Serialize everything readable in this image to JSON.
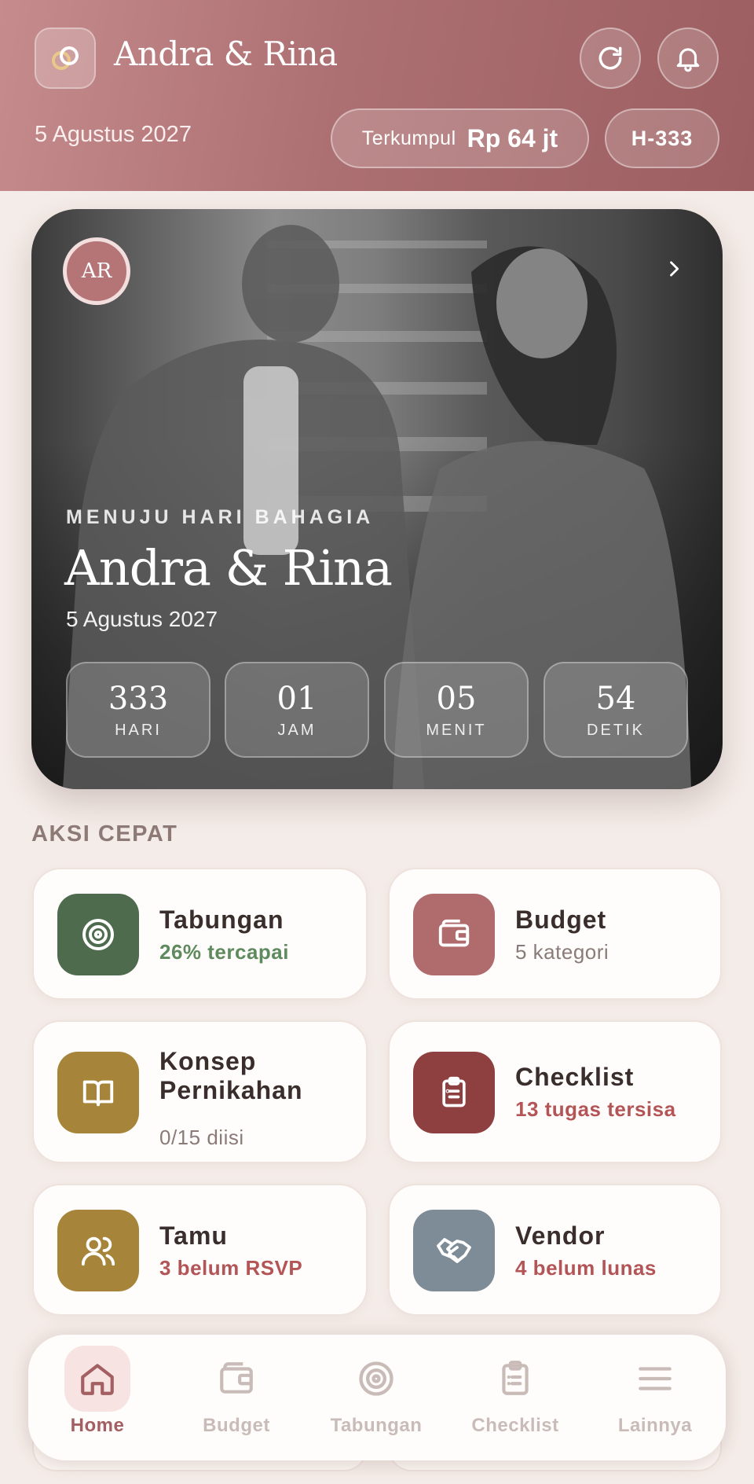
{
  "header": {
    "title": "Andra & Rina",
    "date": "5 Agustus 2027",
    "collected_label": "Terkumpul",
    "collected_value": "Rp 64 jt",
    "countdown_badge": "H-333"
  },
  "hero": {
    "avatar_initials": "AR",
    "eyebrow": "MENUJU HARI BAHAGIA",
    "title": "Andra & Rina",
    "date": "5 Agustus 2027",
    "countdown": [
      {
        "value": "333",
        "label": "HARI"
      },
      {
        "value": "01",
        "label": "JAM"
      },
      {
        "value": "05",
        "label": "MENIT"
      },
      {
        "value": "54",
        "label": "DETIK"
      }
    ]
  },
  "quick_actions": {
    "title": "AKSI CEPAT",
    "items": [
      {
        "title": "Tabungan",
        "subtitle": "26% tercapai",
        "icon": "target-icon",
        "icon_bg": "#4f6b4e",
        "sub_color": "#5e8a5d"
      },
      {
        "title": "Budget",
        "subtitle": "5 kategori",
        "icon": "wallet-icon",
        "icon_bg": "#b06b6d",
        "sub_color": "#8a7b78"
      },
      {
        "title": "Konsep Pernikahan",
        "subtitle": "0/15 diisi",
        "icon": "book-icon",
        "icon_bg": "#a6843a",
        "sub_color": "#8a7b78"
      },
      {
        "title": "Checklist",
        "subtitle": "13 tugas tersisa",
        "icon": "clipboard-icon",
        "icon_bg": "#8e3f40",
        "sub_color": "#b35556"
      },
      {
        "title": "Tamu",
        "subtitle": "3 belum RSVP",
        "icon": "users-icon",
        "icon_bg": "#a6843a",
        "sub_color": "#b35556"
      },
      {
        "title": "Vendor",
        "subtitle": "4 belum lunas",
        "icon": "handshake-icon",
        "icon_bg": "#7e8c97",
        "sub_color": "#b35556"
      }
    ]
  },
  "nav": {
    "items": [
      {
        "label": "Home",
        "icon": "home-icon",
        "active": true
      },
      {
        "label": "Budget",
        "icon": "wallet-icon",
        "active": false
      },
      {
        "label": "Tabungan",
        "icon": "target-icon",
        "active": false
      },
      {
        "label": "Checklist",
        "icon": "clipboard-icon",
        "active": false
      },
      {
        "label": "Lainnya",
        "icon": "menu-icon",
        "active": false
      }
    ]
  },
  "colors": {
    "header_gradient_start": "#c58b8d",
    "header_gradient_end": "#9c5e60",
    "accent": "#a35f61",
    "background": "#f4ece8"
  }
}
